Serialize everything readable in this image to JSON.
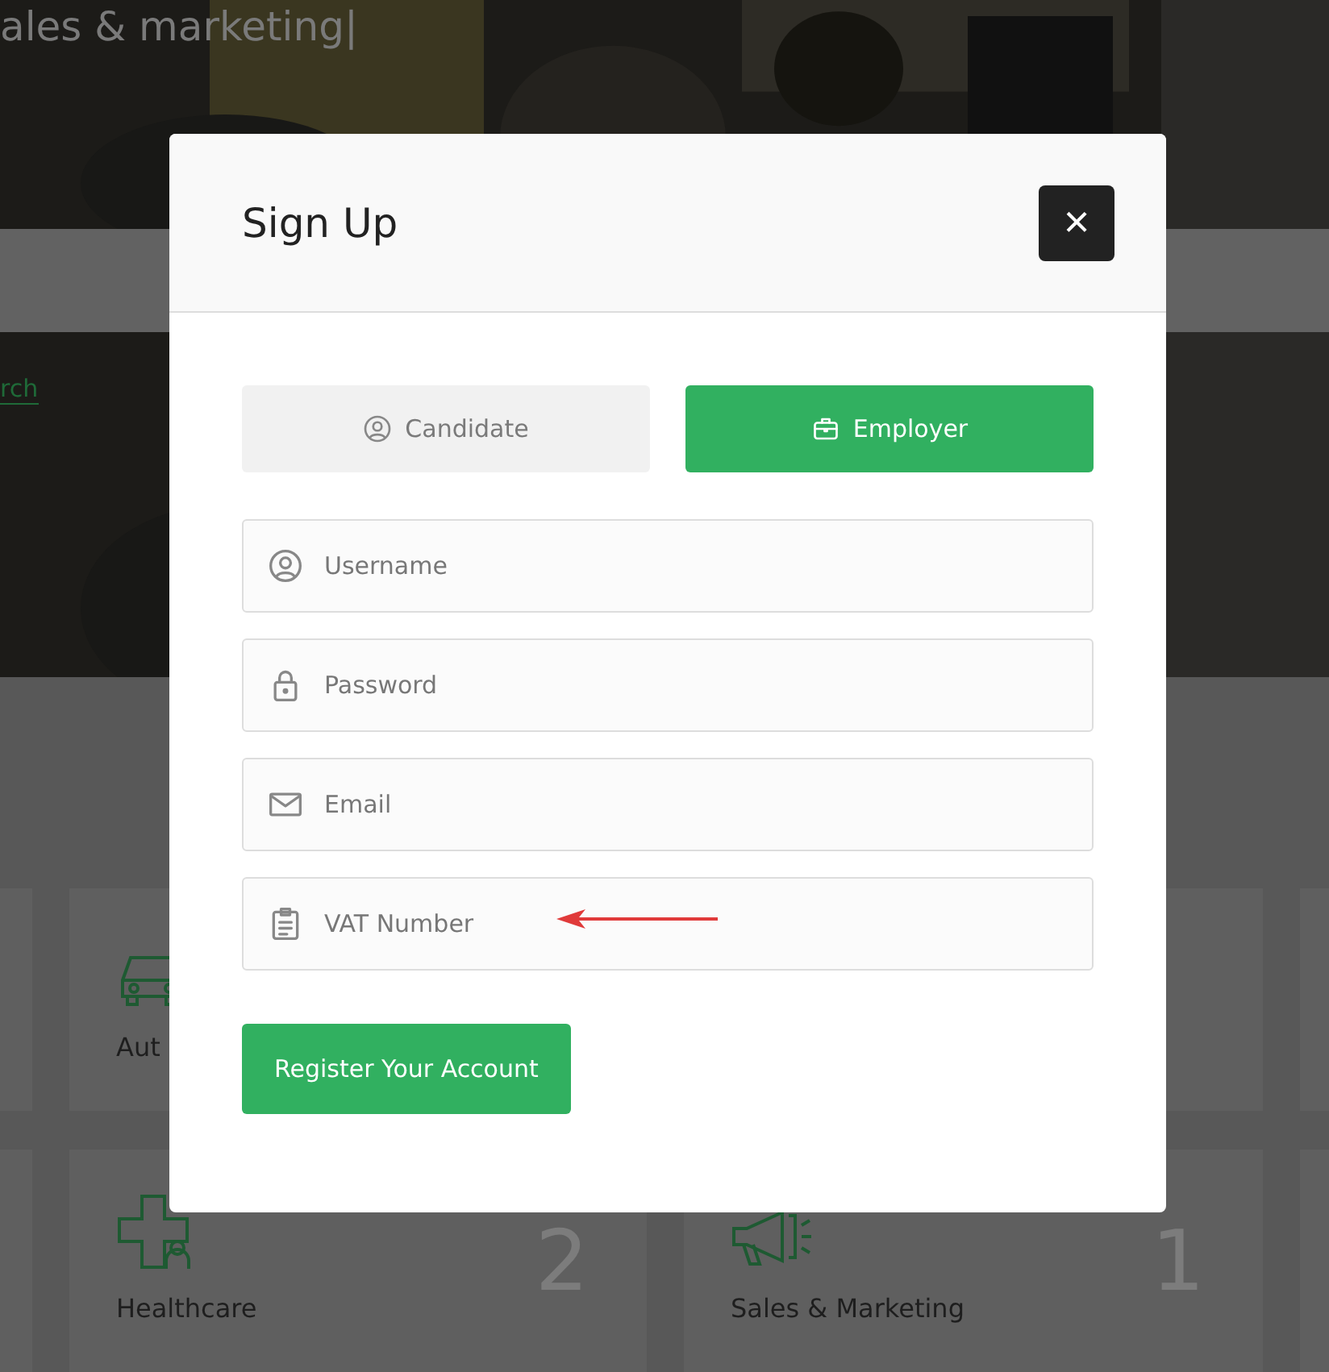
{
  "hero": {
    "headline": "ales & marketing|"
  },
  "search_link": {
    "label": "rch"
  },
  "categories": [
    {
      "kind": "car",
      "name": "Aut"
    },
    {
      "kind": "blank"
    },
    {
      "kind": "medical",
      "name": "Healthcare",
      "count": "2"
    },
    {
      "kind": "megaphone",
      "name": "Sales & Marketing",
      "count": "1"
    }
  ],
  "modal": {
    "title": "Sign Up",
    "close": "×",
    "roles": [
      {
        "label": "Candidate",
        "kind": "user",
        "selected": false
      },
      {
        "label": "Employer",
        "kind": "briefcase",
        "selected": true
      }
    ],
    "fields": [
      {
        "placeholder": "Username",
        "kind": "user"
      },
      {
        "placeholder": "Password",
        "kind": "lock"
      },
      {
        "placeholder": "Email",
        "kind": "mail"
      },
      {
        "placeholder": "VAT Number",
        "kind": "clipboard",
        "annotated": true
      }
    ],
    "submit": "Register Your Account"
  }
}
